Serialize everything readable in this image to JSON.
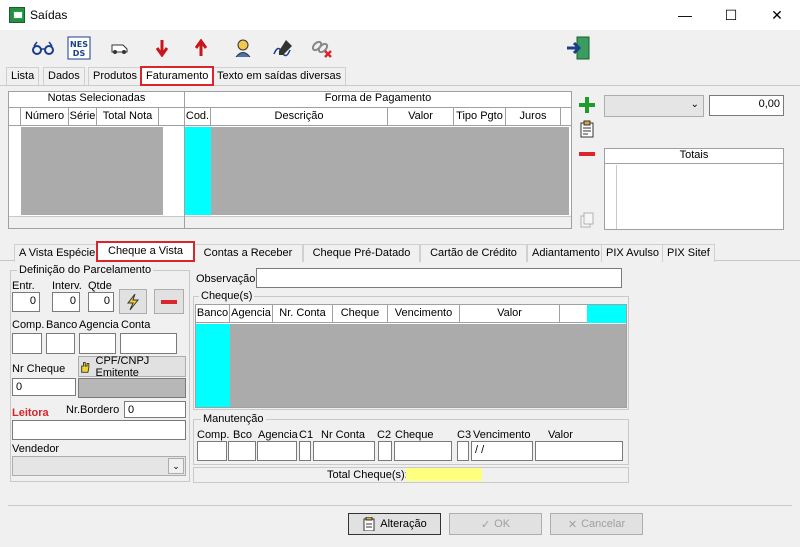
{
  "window": {
    "title": "Saídas",
    "minimize": "—",
    "maximize": "☐",
    "close": "✕"
  },
  "toolbar": {
    "icons": [
      "glasses-icon",
      "nfe-icon",
      "vehicle-icon",
      "arrow-down-icon",
      "arrow-up-icon",
      "person-icon",
      "signature-icon",
      "chain-cancel-icon",
      "exit-icon"
    ],
    "nfe_text": "NES\nDS"
  },
  "tabs": [
    "Lista",
    "Dados",
    "Produtos",
    "Faturamento",
    "Texto em saídas diversas"
  ],
  "notas": {
    "title": "Notas Selecionadas",
    "columns": [
      "Número",
      "Série",
      "Total Nota"
    ]
  },
  "pagamento": {
    "title": "Forma de Pagamento",
    "columns": [
      "Cod.",
      "Descrição",
      "Valor",
      "Tipo Pgto",
      "Juros"
    ]
  },
  "right_panel": {
    "combo_value": "",
    "amount": "0,00",
    "totais_label": "Totais"
  },
  "subtabs": [
    "A Vista Espécie",
    "Cheque a Vista",
    "Contas a Receber",
    "Cheque Pré-Datado",
    "Cartão de Crédito",
    "Adiantamento",
    "PIX Avulso",
    "PIX Sitef"
  ],
  "parcelamento": {
    "title": "Definição do Parcelamento",
    "labels": {
      "entr": "Entr.",
      "interv": "Interv.",
      "qtde": "Qtde"
    },
    "values": {
      "entr": "0",
      "interv": "0",
      "qtde": "0"
    }
  },
  "cheque_form": {
    "labels": {
      "comp": "Comp.",
      "banco": "Banco",
      "agencia": "Agencia",
      "conta": "Conta",
      "nr_cheque": "Nr Cheque",
      "nr_bordero": "Nr.Bordero",
      "leitora": "Leitora",
      "vendedor": "Vendedor",
      "observacao": "Observação"
    },
    "values": {
      "nr_cheque": "0",
      "nr_bordero": "0"
    },
    "cpf_button": "CPF/CNPJ Emitente"
  },
  "cheques": {
    "title": "Cheque(s)",
    "columns": [
      "Banco",
      "Agencia",
      "Nr. Conta",
      "Cheque",
      "Vencimento",
      "Valor"
    ]
  },
  "manutencao": {
    "title": "Manutenção",
    "labels": [
      "Comp.",
      "Bco",
      "Agencia",
      "C1",
      "Nr Conta",
      "C2",
      "Cheque",
      "C3",
      "Vencimento",
      "Valor"
    ],
    "vencimento_value": " / /"
  },
  "total_cheques": {
    "label": "Total Cheque(s):",
    "value": ""
  },
  "footer": {
    "alteracao": "Alteração",
    "ok": "OK",
    "cancelar": "Cancelar"
  }
}
